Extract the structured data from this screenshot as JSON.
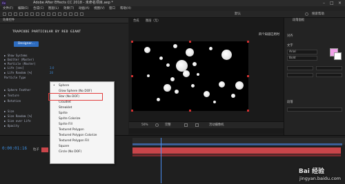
{
  "window": {
    "title": "Adobe After Effects CC 2018 - 未命名项目.aep *",
    "app_icon": "Ae"
  },
  "menu": [
    "文件(F)",
    "编辑(E)",
    "合成(C)",
    "图层(L)",
    "效果(T)",
    "动画(A)",
    "视图(V)",
    "窗口",
    "帮助(H)"
  ],
  "toolbar": {
    "workspace_label": "默认",
    "search_label": "搜索帮助"
  },
  "effects_panel": {
    "header": "效果控件",
    "plugin_name": "TRAPCODE PARTICULAR BY RED GIANT",
    "designer_button": "Designer...",
    "properties": [
      "▶ Show Systems",
      "▶ Emitter (Master)",
      "▼ Particle (Master)",
      "    ▶ Life [sec]",
      "    ▶ Life Random [%]",
      "      Particle Type"
    ],
    "values": [
      "3.0",
      "20"
    ],
    "more_properties": [
      "▶ Sphere Feather",
      "▶ Texture",
      "▶ Rotation",
      "▶ Size",
      "▶ Size Random [%]",
      "▶ Size over Life",
      "▶ Opacity"
    ]
  },
  "particle_type_dropdown": {
    "selected": "Sphere",
    "options": [
      "Sphere",
      "Glow Sphere (No DOF)",
      "Star (No DOF)",
      "Cloudlet",
      "Streaklet",
      "Sprite",
      "Sprite Colorize",
      "Sprite Fill",
      "Textured Polygon",
      "Textured Polygon Colorize",
      "Textured Polygon Fill",
      "Square",
      "Circle (No DOF)"
    ],
    "highlighted": "Star (No DOF)"
  },
  "composition": {
    "header": "合成",
    "tab_label": "图层（无）",
    "overlay_text": "四个知道已用时",
    "viewer_zoom": "50%",
    "viewer_quality": "完整",
    "camera": "活动摄像机"
  },
  "right_panel": {
    "info_label": "段落面板",
    "align_label": "对齐",
    "text_label": "文字",
    "font_value": "Arial",
    "style_value": "Bold",
    "paragraph_label": "段落"
  },
  "timeline": {
    "timecode": "0:00:01:16",
    "layer_name": "粒子",
    "mode": "正常"
  },
  "watermark": {
    "brand": "Bai 经验",
    "url": "jingyan.baidu.com"
  },
  "colors": {
    "accent_blue": "#2d6cc0",
    "layer_red": "#c9454a",
    "highlight_box": "#e23c3c",
    "timecode_blue": "#3d8fe0",
    "swatch_pink": "#f0a0e8"
  }
}
